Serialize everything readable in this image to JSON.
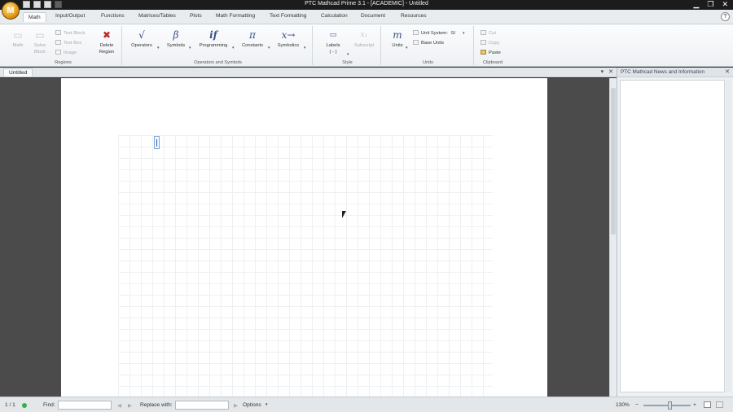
{
  "window": {
    "title": "PTC Mathcad Prime 3.1 - [ACADEMIC] - Untitled",
    "orb_letter": "M",
    "controls": {
      "minimize": "▁",
      "restore": "❐",
      "close": "✕"
    }
  },
  "tabs": [
    "Math",
    "Input/Output",
    "Functions",
    "Matrices/Tables",
    "Plots",
    "Math Formatting",
    "Text Formatting",
    "Calculation",
    "Document",
    "Resources"
  ],
  "active_tab": "Math",
  "help_label": "?",
  "ribbon": {
    "regions": {
      "label": "Regions",
      "math": "Math",
      "solve_block": "Solve Block",
      "text_block": "Text Block",
      "text_box": "Text Box",
      "image": "Image",
      "delete_region": "Delete Region"
    },
    "operators_symbols": {
      "label": "Operators and Symbols",
      "operators": "Operators",
      "symbols": "Symbols",
      "programming": "Programming",
      "constants": "Constants",
      "symbolics": "Symbolics",
      "icon_operators": "√",
      "icon_symbols": "β",
      "icon_programming": "if",
      "icon_constants": "π",
      "icon_symbolics": "x→"
    },
    "style": {
      "label": "Style",
      "labels": "Labels",
      "labels_value": "( - )",
      "subscript": "Subscript"
    },
    "units": {
      "label": "Units",
      "units": "Units",
      "icon_units": "m",
      "unit_system_label": "Unit System:",
      "unit_system_value": "SI",
      "base_units": "Base Units"
    },
    "clipboard": {
      "label": "Clipboard",
      "cut": "Cut",
      "copy": "Copy",
      "paste": "Paste"
    }
  },
  "document": {
    "tab_name": "Untitled",
    "ctl_dropdown": "▾",
    "ctl_close": "✕"
  },
  "side_panel": {
    "title": "PTC Mathcad News and Information",
    "close": "✕"
  },
  "status": {
    "page": "1 / 1",
    "find_label": "Find:",
    "find_value": "",
    "replace_label": "Replace with:",
    "replace_value": "",
    "options": "Options",
    "zoom": "130%",
    "zoom_minus": "−",
    "zoom_plus": "+"
  }
}
